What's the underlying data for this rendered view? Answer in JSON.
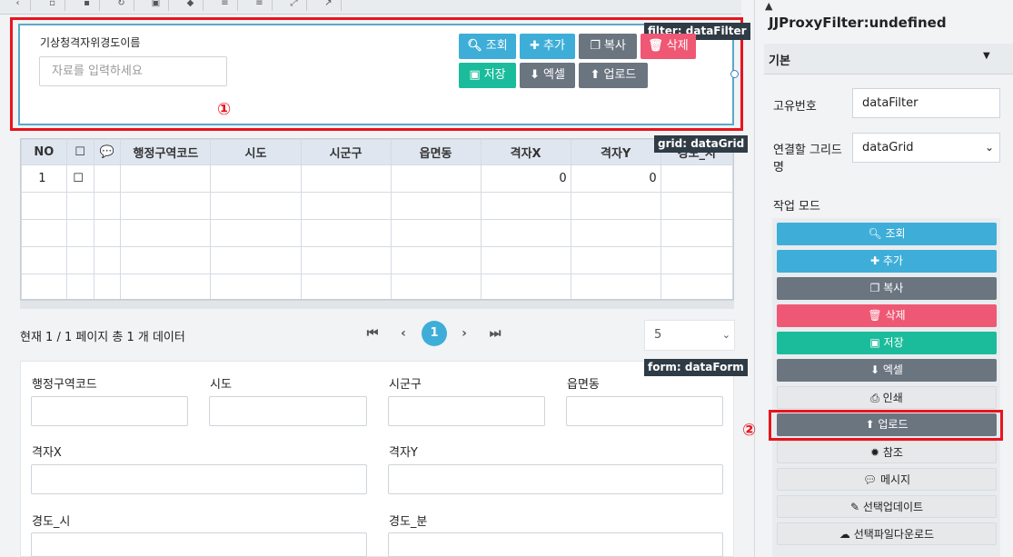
{
  "toolbar": {
    "icons": [
      "undo-icon",
      "copy-icon",
      "paste-icon",
      "redo-icon",
      "save-icon",
      "diamond-icon",
      "align-top-icon",
      "align-bottom-icon",
      "expand-icon",
      "cursor-icon"
    ]
  },
  "filter": {
    "tag": "filter: dataFilter",
    "field_label": "기상청격자위경도이름",
    "placeholder": "자료를 입력하세요",
    "buttons": {
      "search": "조회",
      "add": "추가",
      "copy": "복사",
      "delete": "삭제",
      "save": "저장",
      "excel": "엑셀",
      "upload": "업로드"
    },
    "marker": "①"
  },
  "grid": {
    "tag": "grid: dataGrid",
    "columns": [
      "NO",
      "☐",
      "💬",
      "행정구역코드",
      "시도",
      "시군구",
      "읍면동",
      "격자X",
      "격자Y",
      "경도_시"
    ],
    "rows": [
      [
        "1",
        "☐",
        "",
        "",
        "",
        "",
        "",
        "0",
        "0",
        ""
      ]
    ]
  },
  "pager": {
    "summary": "현재 1 / 1 페이지 총 1 개 데이터",
    "current": "1",
    "page_size": "5"
  },
  "form": {
    "tag": "form: dataForm",
    "fields": [
      "행정구역코드",
      "시도",
      "시군구",
      "읍면동",
      "격자X",
      "격자Y",
      "경도_시",
      "경도_분"
    ]
  },
  "panel": {
    "title": "JJProxyFilter:undefined",
    "section": "기본",
    "id_label": "고유번호",
    "id_value": "dataFilter",
    "grid_label_1": "연결할 그리드",
    "grid_label_2": "명",
    "grid_value": "dataGrid",
    "mode_label": "작업 모드",
    "modes": [
      "조회",
      "추가",
      "복사",
      "삭제",
      "저장",
      "엑셀",
      "인쇄",
      "업로드",
      "참조",
      "메시지",
      "선택업데이트",
      "선택파일다운로드"
    ],
    "marker": "②"
  },
  "colors": {
    "blue": "#3eaed8",
    "gray": "#6b7580",
    "red": "#ef5874",
    "green": "#1bbc9b",
    "highlight": "#e8141d"
  }
}
